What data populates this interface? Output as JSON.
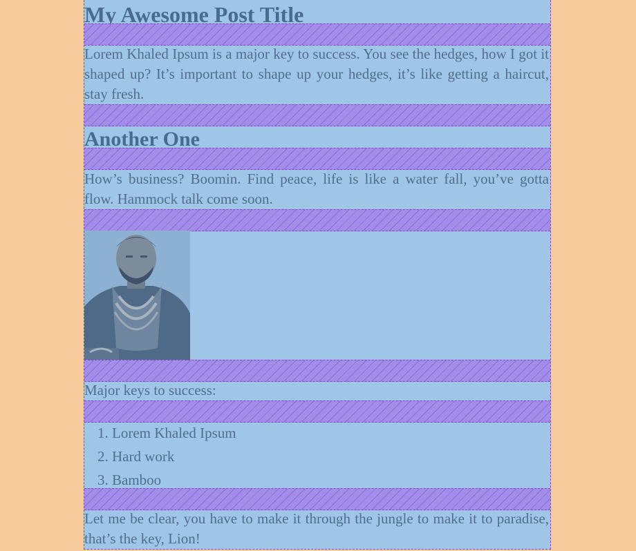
{
  "post": {
    "title": "My Awesome Post Title",
    "intro": "Lorem Khaled Ipsum is a major key to success. You see the hedges, how I got it shaped up? It’s important to shape up your hedges, it’s like getting a haircut, stay fresh.",
    "subtitle": "Another One",
    "paragraph2": "How’s business? Boomin. Find peace, life is like a water fall, you’ve gotta flow. Hammock talk come soon.",
    "image_alt": "DJ Khaled portrait",
    "keys_label": "Major keys to success:",
    "keys": [
      "Lorem Khaled Ipsum",
      "Hard work",
      "Bamboo"
    ],
    "closing": "Let me be clear, you have to make it through the jungle to make it to paradise, that’s the key, Lion!"
  },
  "colors": {
    "page_background": "#f8cb9c",
    "content_background": "#9fc5e7",
    "margin_overlay": "#a28de8",
    "text": "#4f6f8c",
    "outline": "#8b45c7"
  }
}
